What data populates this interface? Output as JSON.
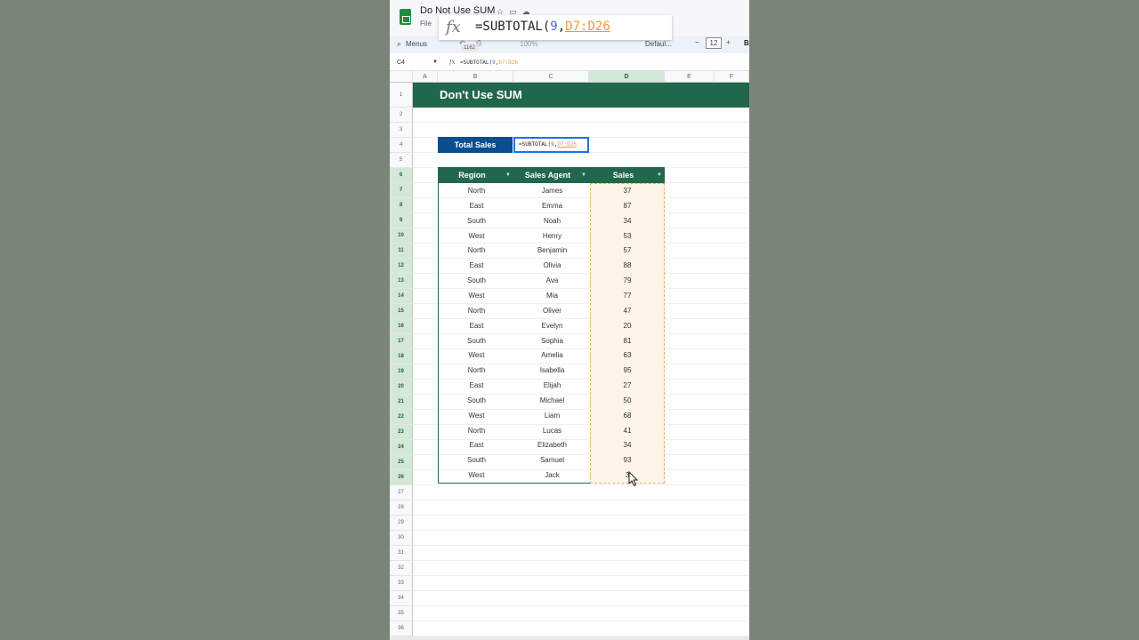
{
  "window": {
    "doc_title": "Do Not Use SUM",
    "menu_file": "File"
  },
  "toolbar": {
    "menus_label": "Menus",
    "zoom": "100%",
    "font": "Defaul...",
    "font_size": "12",
    "bold": "B",
    "minus": "−",
    "plus": "+"
  },
  "formula_bar": {
    "cell_ref": "C4",
    "formula_prefix": "=SUBTOTAL(",
    "formula_num": "9",
    "formula_sep": ",",
    "formula_range": "D7:D26"
  },
  "overlay": {
    "tooltip": "1162"
  },
  "columns": [
    "A",
    "B",
    "C",
    "D",
    "E",
    "F"
  ],
  "rows": [
    "1",
    "2",
    "3",
    "4",
    "5",
    "6",
    "7",
    "8",
    "9",
    "10",
    "11",
    "12",
    "13",
    "14",
    "15",
    "16",
    "17",
    "18",
    "19",
    "20",
    "21",
    "22",
    "23",
    "24",
    "25",
    "26",
    "27",
    "28",
    "29",
    "30",
    "31",
    "32",
    "33",
    "34",
    "35",
    "36"
  ],
  "banner": {
    "title": "Don't Use SUM"
  },
  "total": {
    "label": "Total Sales"
  },
  "table": {
    "headers": {
      "region": "Region",
      "agent": "Sales Agent",
      "sales": "Sales"
    },
    "rows": [
      {
        "region": "North",
        "agent": "James",
        "sales": "37"
      },
      {
        "region": "East",
        "agent": "Emma",
        "sales": "87"
      },
      {
        "region": "South",
        "agent": "Noah",
        "sales": "34"
      },
      {
        "region": "West",
        "agent": "Henry",
        "sales": "53"
      },
      {
        "region": "North",
        "agent": "Benjamin",
        "sales": "57"
      },
      {
        "region": "East",
        "agent": "Olivia",
        "sales": "88"
      },
      {
        "region": "South",
        "agent": "Ava",
        "sales": "79"
      },
      {
        "region": "West",
        "agent": "Mia",
        "sales": "77"
      },
      {
        "region": "North",
        "agent": "Oliver",
        "sales": "47"
      },
      {
        "region": "East",
        "agent": "Evelyn",
        "sales": "20"
      },
      {
        "region": "South",
        "agent": "Sophia",
        "sales": "81"
      },
      {
        "region": "West",
        "agent": "Amelia",
        "sales": "63"
      },
      {
        "region": "North",
        "agent": "Isabella",
        "sales": "95"
      },
      {
        "region": "East",
        "agent": "Elijah",
        "sales": "27"
      },
      {
        "region": "South",
        "agent": "Michael",
        "sales": "50"
      },
      {
        "region": "West",
        "agent": "Liam",
        "sales": "68"
      },
      {
        "region": "North",
        "agent": "Lucas",
        "sales": "41"
      },
      {
        "region": "East",
        "agent": "Elizabeth",
        "sales": "34"
      },
      {
        "region": "South",
        "agent": "Samuel",
        "sales": "93"
      },
      {
        "region": "West",
        "agent": "Jack",
        "sales": "3"
      }
    ]
  },
  "colors": {
    "banner": "#21674b",
    "total_label": "#0b4d8f",
    "selection": "#1a73e8",
    "range_ref": "#f29a3b"
  },
  "icons": [
    "sheets-logo-icon",
    "star-icon",
    "folder-icon",
    "cloud-icon",
    "search-icon",
    "print-icon",
    "filter-icon",
    "fx-icon",
    "cursor-icon"
  ]
}
